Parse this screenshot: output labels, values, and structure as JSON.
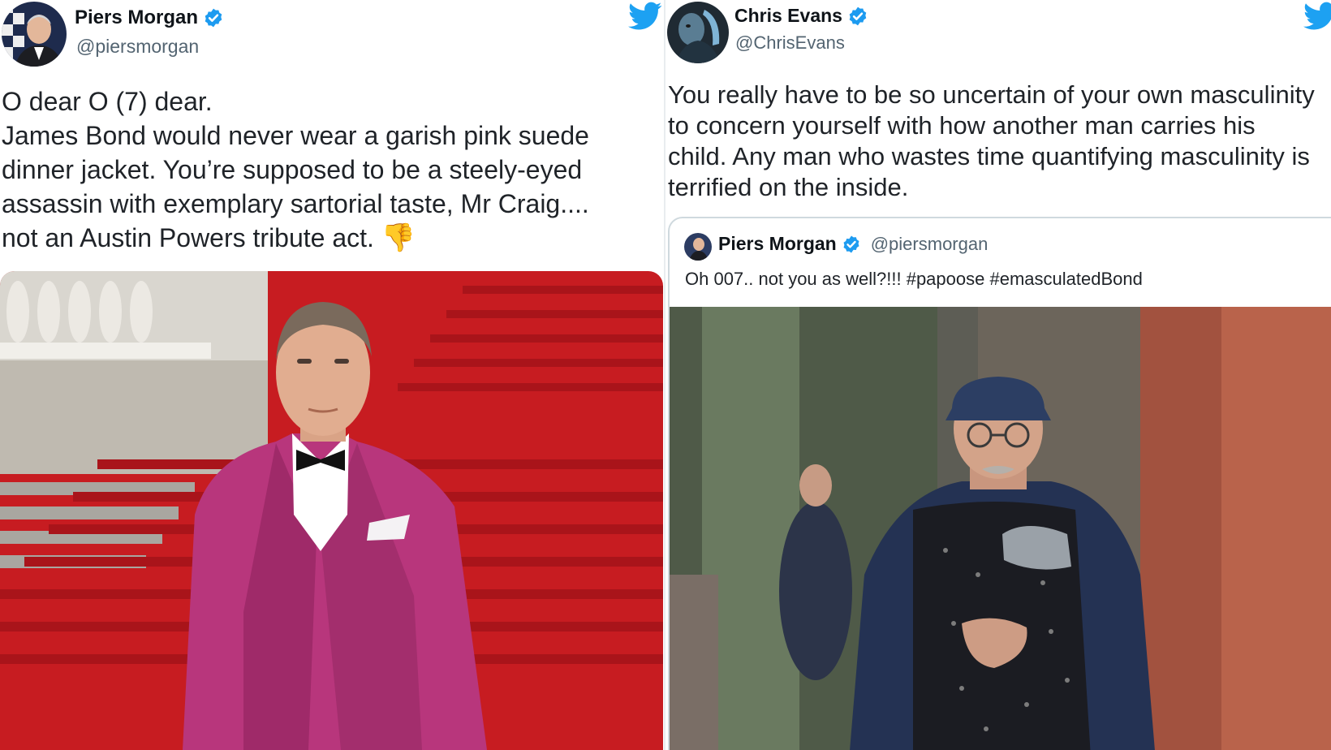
{
  "left_tweet": {
    "author_name": "Piers Morgan",
    "author_handle": "@piersmorgan",
    "verified_icon": "verified-badge-icon",
    "platform_icon": "twitter-bird-icon",
    "text_lines": [
      "O dear O (7) dear.",
      "James Bond would never wear a garish pink suede",
      "dinner jacket. You’re supposed to be a steely-eyed",
      "assassin with exemplary sartorial taste, Mr Craig....",
      "not an Austin Powers tribute act."
    ],
    "emoji_icon": "thumbs-down-icon",
    "emoji_glyph": "👎",
    "media_icon": "red-carpet-photo"
  },
  "right_tweet": {
    "author_name": "Chris Evans",
    "author_handle": "@ChrisEvans",
    "verified_icon": "verified-badge-icon",
    "platform_icon": "twitter-bird-icon",
    "text_lines": [
      "You really have to be so uncertain of your own masculinity",
      "to concern yourself with how another man carries his",
      "child. Any man who wastes time quantifying masculinity is",
      "terrified on the inside."
    ],
    "quoted": {
      "author_name": "Piers Morgan",
      "author_handle": "@piersmorgan",
      "text": "Oh 007.. not you as well?!!! #papoose #emasculatedBond",
      "media_icon": "baby-carrier-photo"
    }
  },
  "colors": {
    "verified_blue": "#1d9bf0",
    "twitter_blue": "#1da1f2",
    "secondary_text": "#536471",
    "jacket_pink": "#b8367c",
    "carpet_red": "#d31f24"
  }
}
